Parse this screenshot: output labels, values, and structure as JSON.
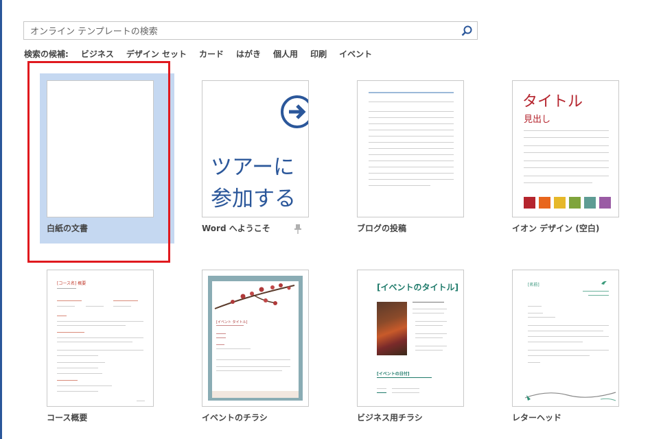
{
  "search": {
    "placeholder": "オンライン テンプレートの検索"
  },
  "suggestions": {
    "label": "検索の候補:",
    "links": [
      "ビジネス",
      "デザイン セット",
      "カード",
      "はがき",
      "個人用",
      "印刷",
      "イベント"
    ]
  },
  "templates": [
    {
      "name": "白紙の文書"
    },
    {
      "name": "Word へようこそ",
      "thumb_text": [
        "ツアーに",
        "参加する"
      ]
    },
    {
      "name": "ブログの投稿"
    },
    {
      "name": "イオン デザイン (空白)",
      "thumb_title": "タイトル",
      "thumb_heading": "見出し",
      "swatches": [
        "#b5252e",
        "#e8661d",
        "#e6b829",
        "#7fa43c",
        "#5e9c94",
        "#9a5ba4"
      ]
    },
    {
      "name": "コース概要",
      "thumb_title": "[コース名] 概要"
    },
    {
      "name": "イベントのチラシ",
      "thumb_title": "[イベント タイトル]"
    },
    {
      "name": "ビジネス用チラシ",
      "thumb_title": "[イベントのタイトル]",
      "thumb_sub": "[イベントの日付]"
    },
    {
      "name": "レターヘッド",
      "thumb_title": "[名前]"
    }
  ],
  "colors": {
    "accent": "#2b579a",
    "selection": "#c5d8f1",
    "highlight_frame": "#e0191e"
  }
}
